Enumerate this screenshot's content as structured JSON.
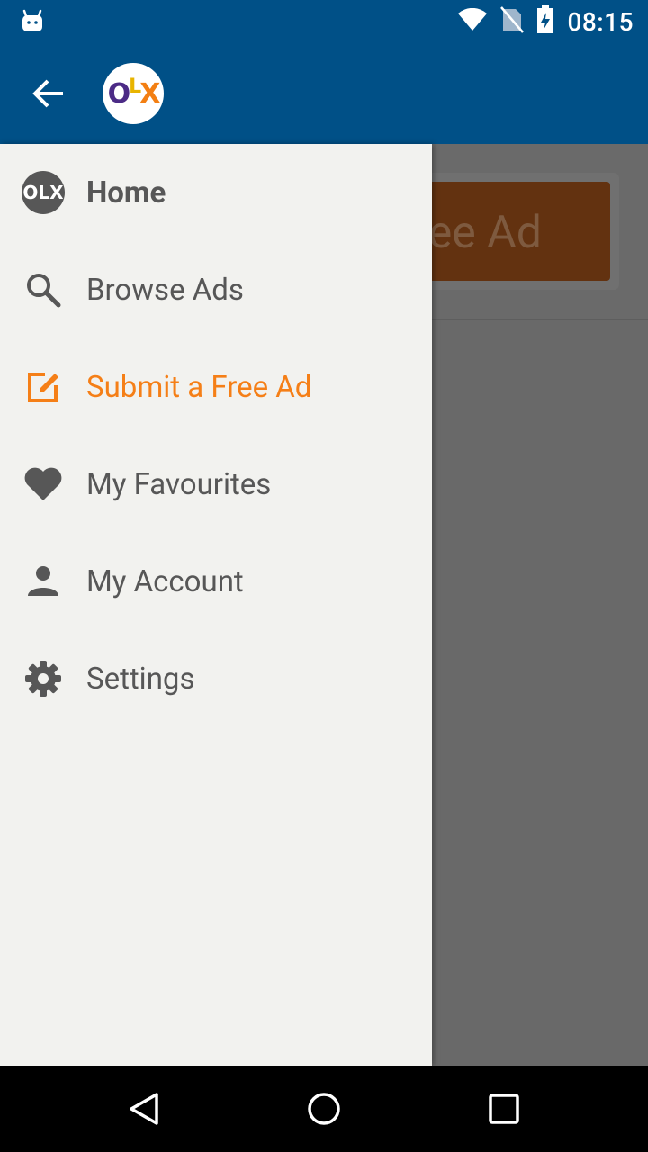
{
  "status_bar": {
    "time": "08:15",
    "icons": [
      "android-icon",
      "wifi-icon",
      "no-sim-icon",
      "battery-charging-icon"
    ]
  },
  "app_bar": {
    "logo_letters": [
      "O",
      "L",
      "X"
    ],
    "colors": {
      "background": "#005087",
      "logo_o": "#4c2b86",
      "logo_l": "#e8b400",
      "logo_x": "#f37f13"
    }
  },
  "behind": {
    "submit_button_label": "Submit a Free Ad"
  },
  "drawer": {
    "items": [
      {
        "label": "Home",
        "icon": "olx-home-icon"
      },
      {
        "label": "Browse Ads",
        "icon": "search-icon"
      },
      {
        "label": "Submit a Free Ad",
        "icon": "edit-icon"
      },
      {
        "label": "My Favourites",
        "icon": "heart-icon"
      },
      {
        "label": "My Account",
        "icon": "person-icon"
      },
      {
        "label": "Settings",
        "icon": "gear-icon"
      }
    ],
    "colors": {
      "text": "#575757",
      "active": "#f57f17",
      "background": "#f2f2ef"
    }
  },
  "nav_bar": {
    "buttons": [
      "back-triangle-icon",
      "home-circle-icon",
      "recents-square-icon"
    ]
  }
}
